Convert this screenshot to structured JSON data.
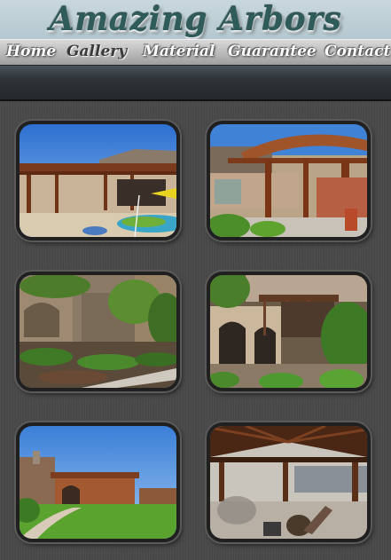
{
  "header": {
    "logo_text": "Amazing Arbors"
  },
  "nav": {
    "items": [
      "Home",
      "Gallery",
      "Material",
      "Guarantee",
      "Contact"
    ],
    "active": "Gallery"
  },
  "gallery": {
    "photos": [
      {
        "subject": "pool-pergola"
      },
      {
        "subject": "curved-arbor"
      },
      {
        "subject": "stone-house-landscape"
      },
      {
        "subject": "stone-patio-pergola"
      },
      {
        "subject": "lawn-pavilion"
      },
      {
        "subject": "gazebo-interior"
      }
    ]
  },
  "colors": {
    "logo": "#2f5c5a",
    "header_bg": "#c9d8de",
    "wood": "#8b4a2a"
  }
}
